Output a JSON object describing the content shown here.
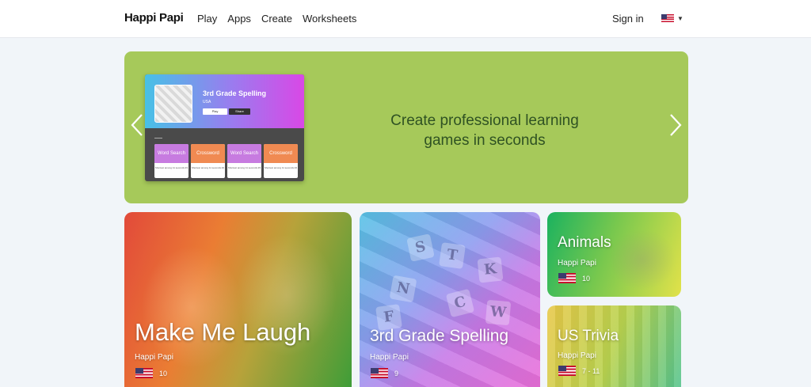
{
  "header": {
    "logo": "Happi Papi",
    "nav": [
      "Play",
      "Apps",
      "Create",
      "Worksheets"
    ],
    "signin": "Sign in",
    "language_flag": "us-flag-icon"
  },
  "hero": {
    "headline_line1": "Create professional learning",
    "headline_line2": "games in seconds",
    "background_color": "#a6c95a",
    "preview": {
      "title": "3rd Grade Spelling",
      "subtitle": "USA",
      "play_label": "Play",
      "share_label": "Share",
      "apps": [
        {
          "name": "Word Search",
          "note": "Shortest among 11 seconds #1"
        },
        {
          "name": "Crossword",
          "note": "Shortest among 11 seconds #2"
        },
        {
          "name": "Word Search",
          "note": "Shortest among 11 seconds #3"
        },
        {
          "name": "Crossword",
          "note": "Shortest among 11 seconds #4"
        }
      ]
    }
  },
  "cards": [
    {
      "title": "Make Me Laugh",
      "author": "Happi Papi",
      "count": "10"
    },
    {
      "title": "3rd Grade Spelling",
      "author": "Happi Papi",
      "count": "9"
    },
    {
      "title": "Animals",
      "author": "Happi Papi",
      "count": "10"
    },
    {
      "title": "US Trivia",
      "author": "Happi Papi",
      "count": "7 - 11"
    }
  ]
}
